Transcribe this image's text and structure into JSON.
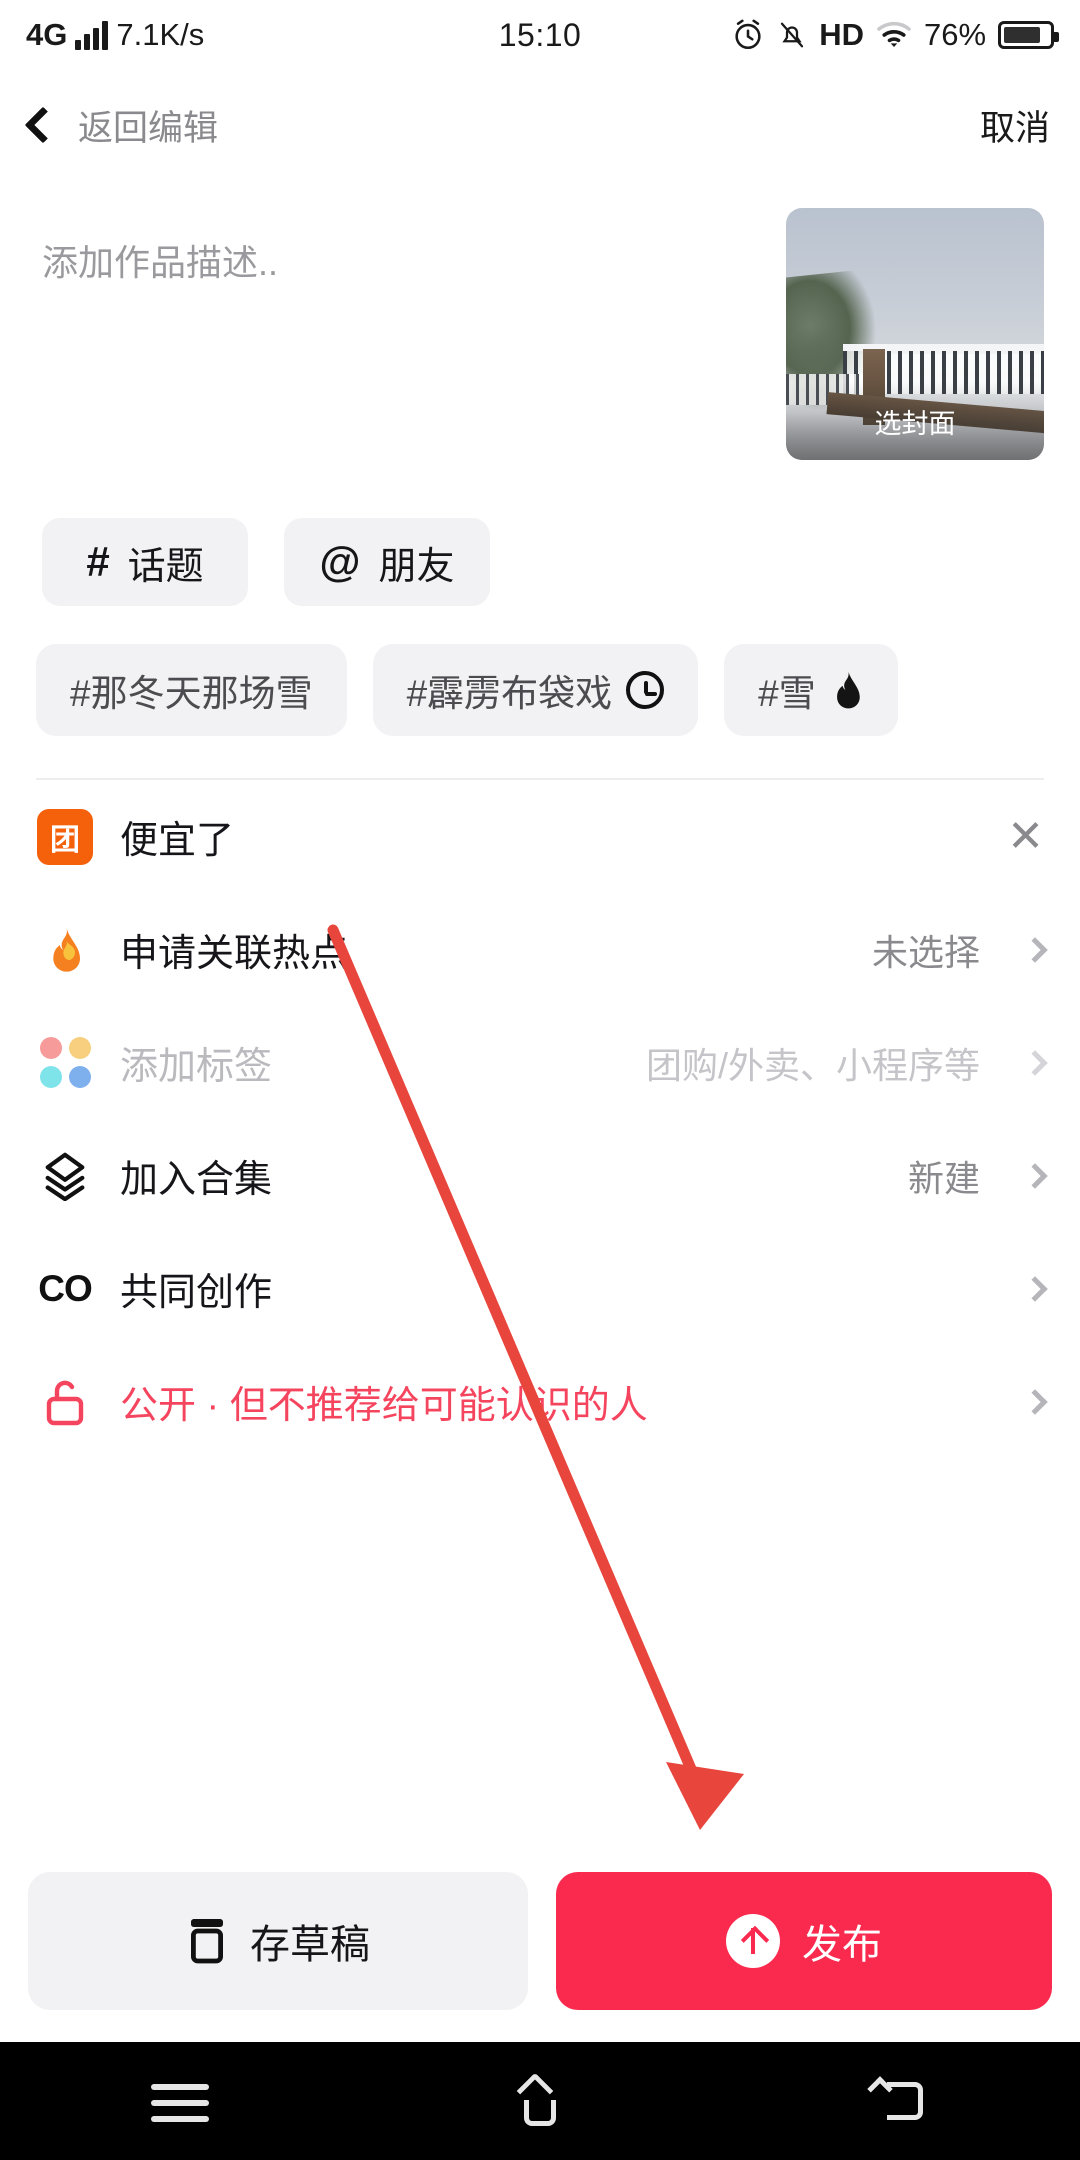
{
  "status_bar": {
    "network": "4G",
    "speed": "7.1K/s",
    "time": "15:10",
    "hd": "HD",
    "battery_percent": "76%",
    "icons": [
      "signal-bars-icon",
      "alarm-clock-icon",
      "mute-bell-icon",
      "hd-icon",
      "wifi-icon",
      "battery-icon"
    ]
  },
  "navbar": {
    "back_label": "返回编辑",
    "cancel_label": "取消"
  },
  "compose": {
    "description_placeholder": "添加作品描述..",
    "cover": {
      "label": "选封面"
    }
  },
  "quick_actions": [
    {
      "icon": "#",
      "label": "话题",
      "name": "topic"
    },
    {
      "icon": "@",
      "label": "朋友",
      "name": "friend"
    }
  ],
  "hashtag_suggestions": [
    {
      "label": "#那冬天那场雪",
      "badge": "none"
    },
    {
      "label": "#霹雳布袋戏",
      "badge": "clock"
    },
    {
      "label": "#雪",
      "badge": "flame"
    }
  ],
  "options": [
    {
      "name": "cheaper",
      "icon": "tuan-icon",
      "icon_text": "团",
      "label": "便宜了",
      "value": "",
      "trailing": "close",
      "disabled": false,
      "danger": false
    },
    {
      "name": "apply-hotspot",
      "icon": "fire-icon",
      "icon_text": "🔥",
      "label": "申请关联热点",
      "value": "未选择",
      "trailing": "chevron",
      "disabled": false,
      "danger": false
    },
    {
      "name": "add-tag",
      "icon": "four-dots-icon",
      "icon_text": "",
      "label": "添加标签",
      "value": "团购/外卖、小程序等",
      "trailing": "chevron",
      "disabled": true,
      "danger": false
    },
    {
      "name": "join-collection",
      "icon": "layers-icon",
      "icon_text": "",
      "label": "加入合集",
      "value": "新建",
      "trailing": "chevron",
      "disabled": false,
      "danger": false
    },
    {
      "name": "co-creation",
      "icon": "co-icon",
      "icon_text": "CO",
      "label": "共同创作",
      "value": "",
      "trailing": "chevron",
      "disabled": false,
      "danger": false
    },
    {
      "name": "privacy",
      "icon": "unlock-icon",
      "icon_text": "",
      "label": "公开 · 但不推荐给可能认识的人",
      "value": "",
      "trailing": "chevron",
      "disabled": false,
      "danger": true
    }
  ],
  "footer": {
    "draft_label": "存草稿",
    "publish_label": "发布"
  },
  "system_nav": {
    "menu": "menu-icon",
    "home": "home-icon",
    "back": "back-icon"
  },
  "colors": {
    "accent_red": "#fa2a4f",
    "danger_text": "#f5455e",
    "chip_bg": "#f2f2f4",
    "muted_text": "#8a8a8e",
    "tuan_orange": "#f5600a",
    "annotation_arrow": "#e8453c"
  },
  "annotation": {
    "type": "arrow",
    "description": "red arrow from list area to publish button"
  }
}
